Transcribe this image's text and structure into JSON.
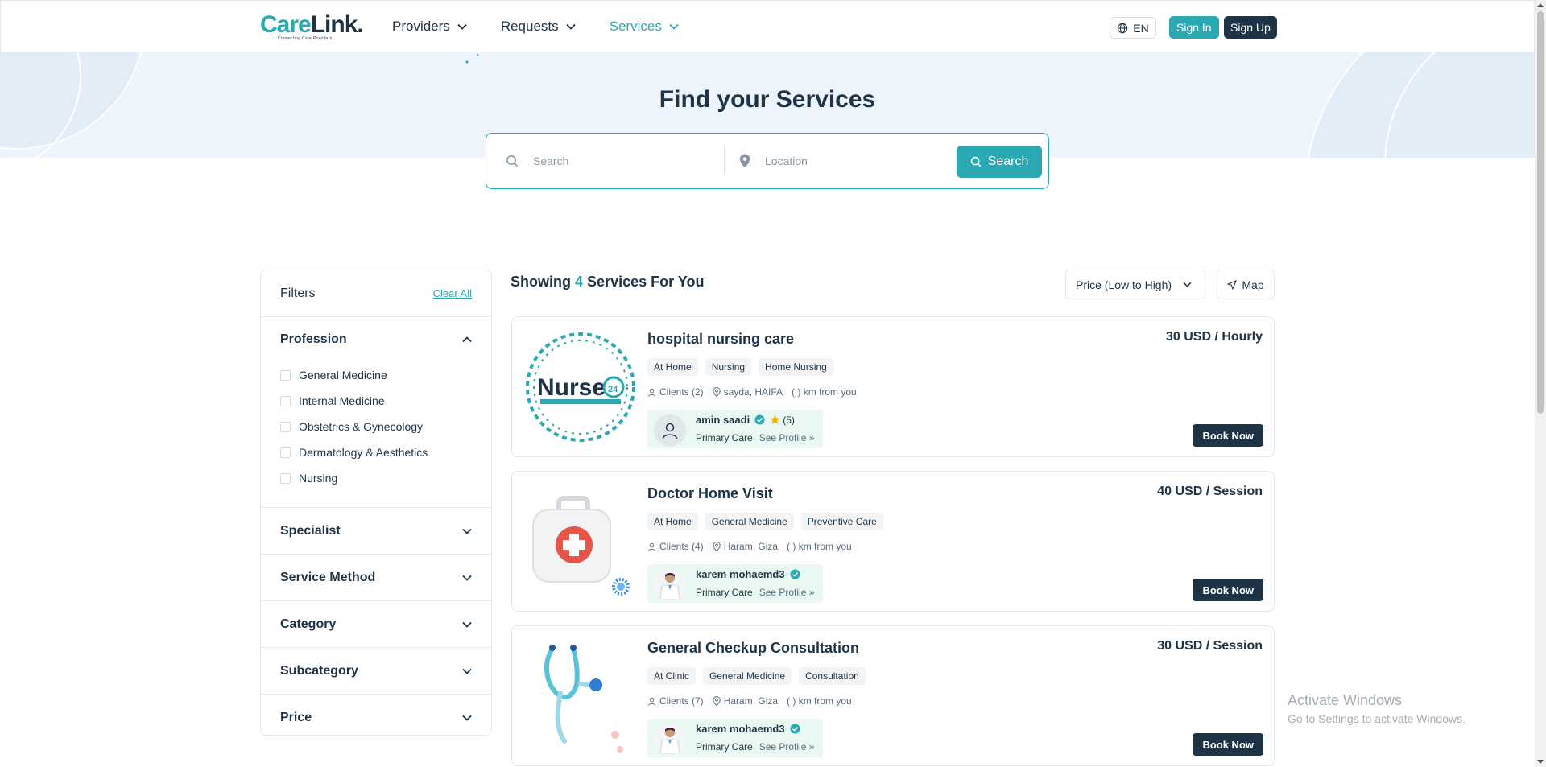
{
  "header": {
    "logo_care": "Care",
    "logo_link": "Link.",
    "logo_tagline": "Connecting Care Providers",
    "nav": [
      {
        "label": "Providers",
        "active": false
      },
      {
        "label": "Requests",
        "active": false
      },
      {
        "label": "Services",
        "active": true
      }
    ],
    "language": "EN",
    "sign_in": "Sign In",
    "sign_up": "Sign Up"
  },
  "hero": {
    "title": "Find your Services",
    "search_placeholder": "Search",
    "location_placeholder": "Location",
    "search_button": "Search"
  },
  "filters": {
    "title": "Filters",
    "clear_all": "Clear All",
    "profession": {
      "title": "Profession",
      "options": [
        "General Medicine",
        "Internal Medicine",
        "Obstetrics & Gynecology",
        "Dermatology & Aesthetics",
        "Nursing"
      ]
    },
    "sections": [
      "Specialist",
      "Service Method",
      "Category",
      "Subcategory",
      "Price"
    ]
  },
  "results": {
    "showing_prefix": "Showing",
    "count": "4",
    "showing_suffix": "Services For You",
    "sort": "Price (Low to High)",
    "map": "Map",
    "services": [
      {
        "title": "hospital nursing care",
        "price": "30 USD / Hourly",
        "tags": [
          "At Home",
          "Nursing",
          "Home Nursing"
        ],
        "clients": "Clients (2)",
        "location": "sayda, HAIFA",
        "distance": "( ) km from you",
        "provider": "amin saadi",
        "rating": "(5)",
        "provider_type": "Primary Care",
        "see_profile": "See Profile",
        "book": "Book Now",
        "image": "nurse-logo"
      },
      {
        "title": "Doctor Home Visit",
        "price": "40 USD / Session",
        "tags": [
          "At Home",
          "General Medicine",
          "Preventive Care"
        ],
        "clients": "Clients (4)",
        "location": "Haram, Giza",
        "distance": "( ) km from you",
        "provider": "karem mohaemd3",
        "rating": "",
        "provider_type": "Primary Care",
        "see_profile": "See Profile",
        "book": "Book Now",
        "image": "first-aid-kit"
      },
      {
        "title": "General Checkup Consultation",
        "price": "30 USD / Session",
        "tags": [
          "At Clinic",
          "General Medicine",
          "Consultation"
        ],
        "clients": "Clients (7)",
        "location": "Haram, Giza",
        "distance": "( ) km from you",
        "provider": "karem mohaemd3",
        "rating": "",
        "provider_type": "Primary Care",
        "see_profile": "See Profile",
        "book": "Book Now",
        "image": "stethoscope"
      }
    ]
  },
  "watermark": {
    "line1": "Activate Windows",
    "line2": "Go to Settings to activate Windows."
  },
  "colors": {
    "primary": "#2aa9b3",
    "dark": "#1e3346",
    "hero_bg": "#eef4fb",
    "provider_bg": "#eaf8f3"
  }
}
